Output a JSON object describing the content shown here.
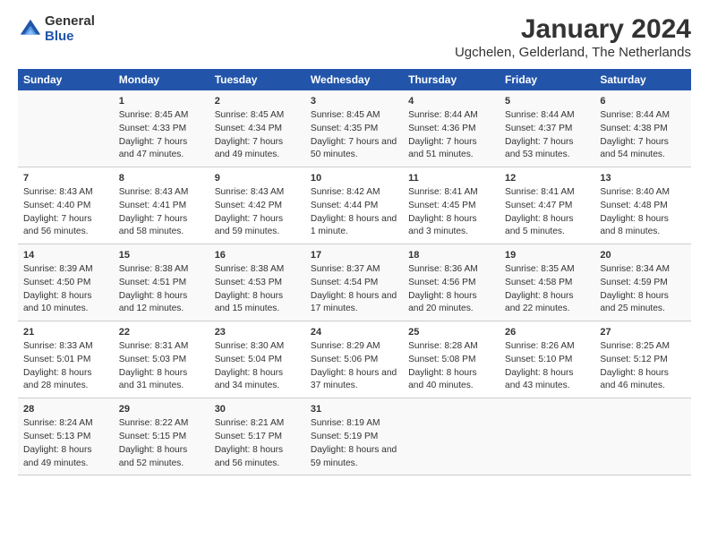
{
  "logo": {
    "general": "General",
    "blue": "Blue"
  },
  "header": {
    "title": "January 2024",
    "subtitle": "Ugchelen, Gelderland, The Netherlands"
  },
  "days": [
    "Sunday",
    "Monday",
    "Tuesday",
    "Wednesday",
    "Thursday",
    "Friday",
    "Saturday"
  ],
  "weeks": [
    {
      "cells": [
        {
          "date": "",
          "sunrise": "",
          "sunset": "",
          "daylight": ""
        },
        {
          "date": "1",
          "sunrise": "Sunrise: 8:45 AM",
          "sunset": "Sunset: 4:33 PM",
          "daylight": "Daylight: 7 hours and 47 minutes."
        },
        {
          "date": "2",
          "sunrise": "Sunrise: 8:45 AM",
          "sunset": "Sunset: 4:34 PM",
          "daylight": "Daylight: 7 hours and 49 minutes."
        },
        {
          "date": "3",
          "sunrise": "Sunrise: 8:45 AM",
          "sunset": "Sunset: 4:35 PM",
          "daylight": "Daylight: 7 hours and 50 minutes."
        },
        {
          "date": "4",
          "sunrise": "Sunrise: 8:44 AM",
          "sunset": "Sunset: 4:36 PM",
          "daylight": "Daylight: 7 hours and 51 minutes."
        },
        {
          "date": "5",
          "sunrise": "Sunrise: 8:44 AM",
          "sunset": "Sunset: 4:37 PM",
          "daylight": "Daylight: 7 hours and 53 minutes."
        },
        {
          "date": "6",
          "sunrise": "Sunrise: 8:44 AM",
          "sunset": "Sunset: 4:38 PM",
          "daylight": "Daylight: 7 hours and 54 minutes."
        }
      ]
    },
    {
      "cells": [
        {
          "date": "7",
          "sunrise": "Sunrise: 8:43 AM",
          "sunset": "Sunset: 4:40 PM",
          "daylight": "Daylight: 7 hours and 56 minutes."
        },
        {
          "date": "8",
          "sunrise": "Sunrise: 8:43 AM",
          "sunset": "Sunset: 4:41 PM",
          "daylight": "Daylight: 7 hours and 58 minutes."
        },
        {
          "date": "9",
          "sunrise": "Sunrise: 8:43 AM",
          "sunset": "Sunset: 4:42 PM",
          "daylight": "Daylight: 7 hours and 59 minutes."
        },
        {
          "date": "10",
          "sunrise": "Sunrise: 8:42 AM",
          "sunset": "Sunset: 4:44 PM",
          "daylight": "Daylight: 8 hours and 1 minute."
        },
        {
          "date": "11",
          "sunrise": "Sunrise: 8:41 AM",
          "sunset": "Sunset: 4:45 PM",
          "daylight": "Daylight: 8 hours and 3 minutes."
        },
        {
          "date": "12",
          "sunrise": "Sunrise: 8:41 AM",
          "sunset": "Sunset: 4:47 PM",
          "daylight": "Daylight: 8 hours and 5 minutes."
        },
        {
          "date": "13",
          "sunrise": "Sunrise: 8:40 AM",
          "sunset": "Sunset: 4:48 PM",
          "daylight": "Daylight: 8 hours and 8 minutes."
        }
      ]
    },
    {
      "cells": [
        {
          "date": "14",
          "sunrise": "Sunrise: 8:39 AM",
          "sunset": "Sunset: 4:50 PM",
          "daylight": "Daylight: 8 hours and 10 minutes."
        },
        {
          "date": "15",
          "sunrise": "Sunrise: 8:38 AM",
          "sunset": "Sunset: 4:51 PM",
          "daylight": "Daylight: 8 hours and 12 minutes."
        },
        {
          "date": "16",
          "sunrise": "Sunrise: 8:38 AM",
          "sunset": "Sunset: 4:53 PM",
          "daylight": "Daylight: 8 hours and 15 minutes."
        },
        {
          "date": "17",
          "sunrise": "Sunrise: 8:37 AM",
          "sunset": "Sunset: 4:54 PM",
          "daylight": "Daylight: 8 hours and 17 minutes."
        },
        {
          "date": "18",
          "sunrise": "Sunrise: 8:36 AM",
          "sunset": "Sunset: 4:56 PM",
          "daylight": "Daylight: 8 hours and 20 minutes."
        },
        {
          "date": "19",
          "sunrise": "Sunrise: 8:35 AM",
          "sunset": "Sunset: 4:58 PM",
          "daylight": "Daylight: 8 hours and 22 minutes."
        },
        {
          "date": "20",
          "sunrise": "Sunrise: 8:34 AM",
          "sunset": "Sunset: 4:59 PM",
          "daylight": "Daylight: 8 hours and 25 minutes."
        }
      ]
    },
    {
      "cells": [
        {
          "date": "21",
          "sunrise": "Sunrise: 8:33 AM",
          "sunset": "Sunset: 5:01 PM",
          "daylight": "Daylight: 8 hours and 28 minutes."
        },
        {
          "date": "22",
          "sunrise": "Sunrise: 8:31 AM",
          "sunset": "Sunset: 5:03 PM",
          "daylight": "Daylight: 8 hours and 31 minutes."
        },
        {
          "date": "23",
          "sunrise": "Sunrise: 8:30 AM",
          "sunset": "Sunset: 5:04 PM",
          "daylight": "Daylight: 8 hours and 34 minutes."
        },
        {
          "date": "24",
          "sunrise": "Sunrise: 8:29 AM",
          "sunset": "Sunset: 5:06 PM",
          "daylight": "Daylight: 8 hours and 37 minutes."
        },
        {
          "date": "25",
          "sunrise": "Sunrise: 8:28 AM",
          "sunset": "Sunset: 5:08 PM",
          "daylight": "Daylight: 8 hours and 40 minutes."
        },
        {
          "date": "26",
          "sunrise": "Sunrise: 8:26 AM",
          "sunset": "Sunset: 5:10 PM",
          "daylight": "Daylight: 8 hours and 43 minutes."
        },
        {
          "date": "27",
          "sunrise": "Sunrise: 8:25 AM",
          "sunset": "Sunset: 5:12 PM",
          "daylight": "Daylight: 8 hours and 46 minutes."
        }
      ]
    },
    {
      "cells": [
        {
          "date": "28",
          "sunrise": "Sunrise: 8:24 AM",
          "sunset": "Sunset: 5:13 PM",
          "daylight": "Daylight: 8 hours and 49 minutes."
        },
        {
          "date": "29",
          "sunrise": "Sunrise: 8:22 AM",
          "sunset": "Sunset: 5:15 PM",
          "daylight": "Daylight: 8 hours and 52 minutes."
        },
        {
          "date": "30",
          "sunrise": "Sunrise: 8:21 AM",
          "sunset": "Sunset: 5:17 PM",
          "daylight": "Daylight: 8 hours and 56 minutes."
        },
        {
          "date": "31",
          "sunrise": "Sunrise: 8:19 AM",
          "sunset": "Sunset: 5:19 PM",
          "daylight": "Daylight: 8 hours and 59 minutes."
        },
        {
          "date": "",
          "sunrise": "",
          "sunset": "",
          "daylight": ""
        },
        {
          "date": "",
          "sunrise": "",
          "sunset": "",
          "daylight": ""
        },
        {
          "date": "",
          "sunrise": "",
          "sunset": "",
          "daylight": ""
        }
      ]
    }
  ]
}
